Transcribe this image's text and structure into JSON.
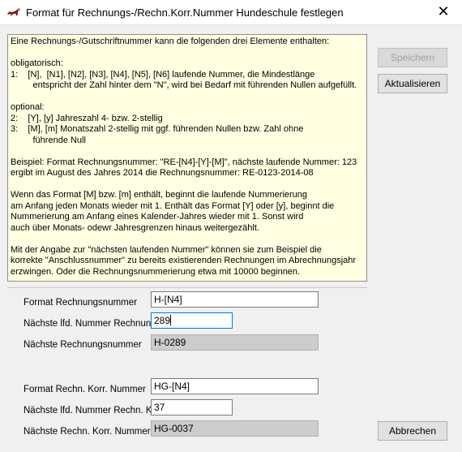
{
  "window": {
    "title": "Format für Rechnungs-/Rechn.Korr.Nummer Hundeschule festlegen",
    "close_glyph": "✕"
  },
  "info_lines": [
    "Eine Rechnungs-/Gutschriftnummer kann die folgenden drei Elemente enthalten:",
    "",
    "obligatorisch:",
    "1:    [N],  [N1], [N2], [N3], [N4], [N5], [N6] laufende Nummer, die Mindestlänge",
    "         entspricht der Zahl hinter dem \"N\", wird bei Bedarf mit führenden Nullen aufgefüllt.",
    "",
    "optional:",
    "2:    [Y], [y] Jahreszahl 4- bzw. 2-stellig",
    "3:    [M], [m] Monatszahl 2-stellig mit ggf. führenden Nullen bzw. Zahl ohne",
    "         führende Null",
    "",
    "Beispiel: Format Rechnungsnummer: \"RE-[N4]-[Y]-[M]\", nächste laufende Nummer: 123",
    "ergibt im August des Jahres 2014 die Rechnungsnummer: RE-0123-2014-08",
    "",
    "Wenn das Format [M] bzw. [m] enthält, beginnt die laufende Nummerierung",
    "am Anfang jeden Monats wieder mit 1. Enthält das Format [Y] oder [y], beginnt die",
    "Nummerierung am Anfang eines Kalender-Jahres wieder mit 1. Sonst wird",
    "auch über Monats- odewr Jahresgrenzen hinaus weitergezählt.",
    "",
    "Mit der Angabe zur \"nächsten laufenden Nummer\" können sie zum Beispiel die",
    "korrekte \"Anschlussnummer\" zu bereits existierenden Rechnungen im Abrechnungsjahr",
    "erzwingen. Oder die Rechnungsnummerierung etwa mit 10000 beginnen."
  ],
  "form": {
    "format_rechnung": {
      "label": "Format Rechnungsnummer",
      "value": "H-[N4]"
    },
    "naechste_nr_rechnung": {
      "label": "Nächste lfd. Nummer Rechnung",
      "value": "289"
    },
    "naechste_rechnungsnummer": {
      "label": "Nächste Rechnungsnummer",
      "value": "H-0289"
    },
    "format_korr": {
      "label": "Format Rechn. Korr. Nummer",
      "value": "HG-[N4]"
    },
    "naechste_nr_korr": {
      "label": "Nächste lfd. Nummer Rechn. Korr",
      "value": "37"
    },
    "naechste_korr_nummer": {
      "label": "Nächste Rechn. Korr. Nummer",
      "value": "HG-0037"
    }
  },
  "buttons": {
    "save": "Speichern",
    "refresh": "Aktualisieren",
    "cancel": "Abbrechen"
  }
}
